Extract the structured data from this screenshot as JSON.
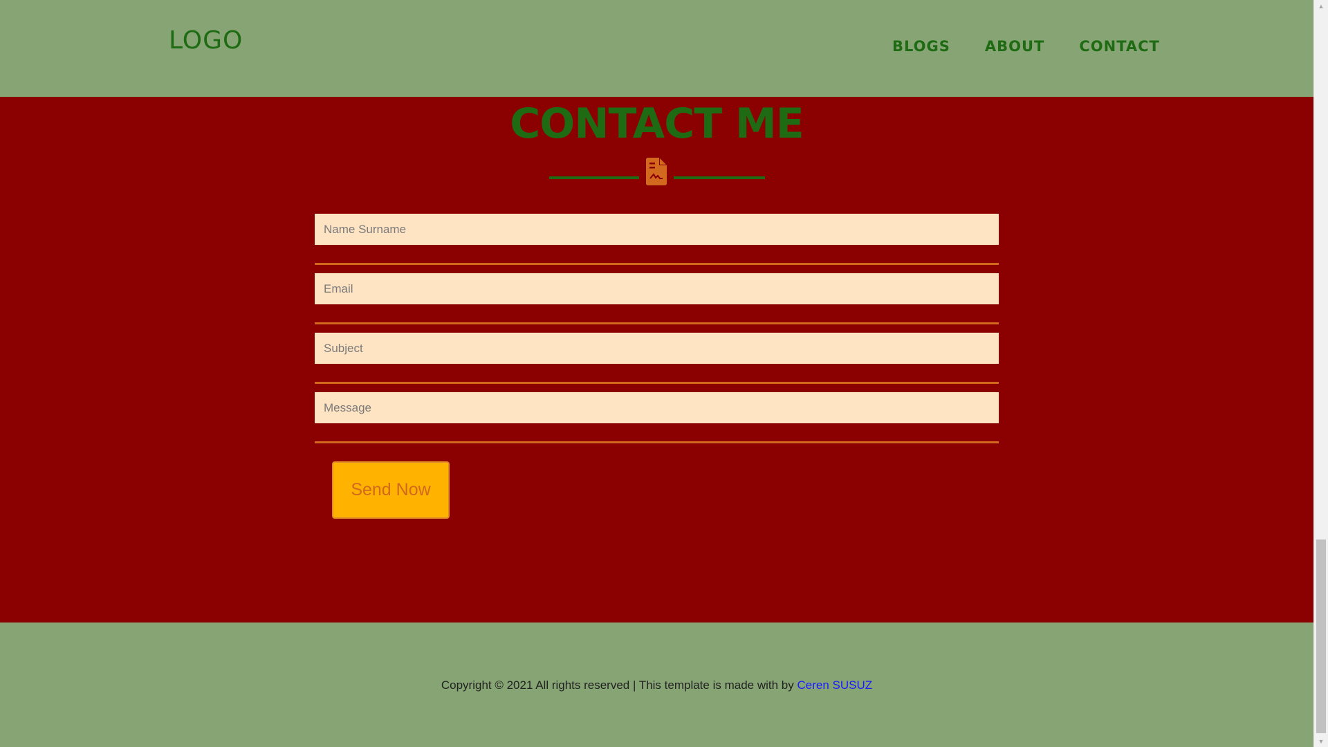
{
  "header": {
    "logo": "LOGO",
    "nav": [
      {
        "label": "BLOGS"
      },
      {
        "label": "ABOUT"
      },
      {
        "label": "CONTACT"
      }
    ]
  },
  "contact": {
    "title": "CONTACT ME",
    "icon": "document-signature-icon",
    "fields": [
      {
        "placeholder": "Name Surname",
        "value": ""
      },
      {
        "placeholder": "Email",
        "value": ""
      },
      {
        "placeholder": "Subject",
        "value": ""
      },
      {
        "placeholder": "Message",
        "value": ""
      }
    ],
    "send_label": "Send Now"
  },
  "footer": {
    "text": "Copyright © 2021 All rights reserved | This template is made with  by ",
    "author": "Ceren SUSUZ"
  },
  "colors": {
    "header_bg": "#87a574",
    "section_bg": "#8b0000",
    "accent_green": "#1f6b14",
    "input_bg": "#ffe4c4",
    "underline": "#d2691e",
    "button_bg": "#ffb300",
    "link": "#1a1aff"
  }
}
